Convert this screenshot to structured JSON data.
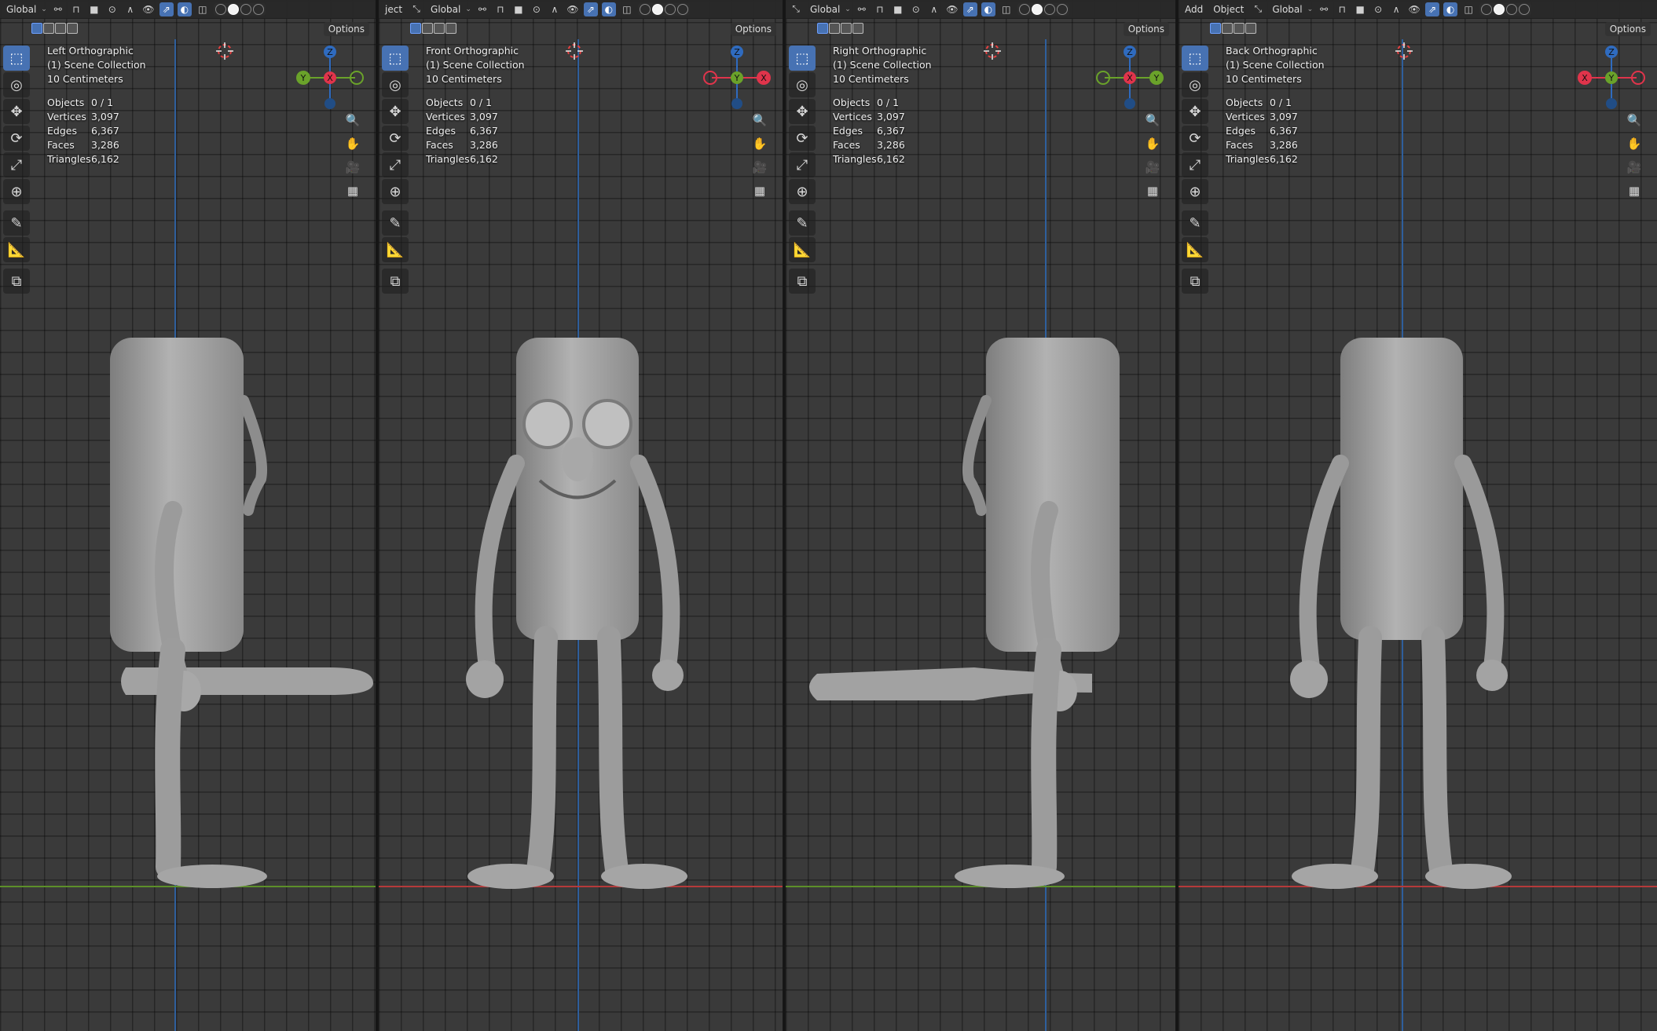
{
  "viewports": [
    {
      "header_left": "Global",
      "view_name": "Left Orthographic",
      "collection": "(1) Scene Collection",
      "scale": "10 Centimeters",
      "stats": {
        "objects_label": "Objects",
        "objects": "0 / 1",
        "vertices_label": "Vertices",
        "vertices": "3,097",
        "edges_label": "Edges",
        "edges": "6,367",
        "faces_label": "Faces",
        "faces": "3,286",
        "triangles_label": "Triangles",
        "triangles": "6,162"
      },
      "options_label": "Options",
      "ground_axis_color": "#5d8f2a",
      "gizmo": {
        "top": "Z",
        "left": "Y",
        "center": "X",
        "right_color": "#6aa22a",
        "left_color": "#6aa22a",
        "center_color": "#e0344b"
      }
    },
    {
      "header_left": "ject",
      "header_global": "Global",
      "view_name": "Front Orthographic",
      "collection": "(1) Scene Collection",
      "scale": "10 Centimeters",
      "stats": {
        "objects_label": "Objects",
        "objects": "0 / 1",
        "vertices_label": "Vertices",
        "vertices": "3,097",
        "edges_label": "Edges",
        "edges": "6,367",
        "faces_label": "Faces",
        "faces": "3,286",
        "triangles_label": "Triangles",
        "triangles": "6,162"
      },
      "options_label": "Options",
      "ground_axis_color": "#b53a3a",
      "gizmo": {
        "top": "Z",
        "left": "",
        "center": "Y",
        "right": "X",
        "right_color": "#e0344b",
        "left_color": "#e0344b",
        "center_color": "#6aa22a"
      }
    },
    {
      "header_global": "Global",
      "view_name": "Right Orthographic",
      "collection": "(1) Scene Collection",
      "scale": "10 Centimeters",
      "stats": {
        "objects_label": "Objects",
        "objects": "0 / 1",
        "vertices_label": "Vertices",
        "vertices": "3,097",
        "edges_label": "Edges",
        "edges": "6,367",
        "faces_label": "Faces",
        "faces": "3,286",
        "triangles_label": "Triangles",
        "triangles": "6,162"
      },
      "options_label": "Options",
      "ground_axis_color": "#5d8f2a",
      "gizmo": {
        "top": "Z",
        "left": "",
        "center": "X",
        "right": "Y",
        "right_color": "#6aa22a",
        "left_color": "#6aa22a",
        "center_color": "#e0344b"
      }
    },
    {
      "header_add": "Add",
      "header_object": "Object",
      "header_global": "Global",
      "view_name": "Back Orthographic",
      "collection": "(1) Scene Collection",
      "scale": "10 Centimeters",
      "stats": {
        "objects_label": "Objects",
        "objects": "0 / 1",
        "vertices_label": "Vertices",
        "vertices": "3,097",
        "edges_label": "Edges",
        "edges": "6,367",
        "faces_label": "Faces",
        "faces": "3,286",
        "triangles_label": "Triangles",
        "triangles": "6,162"
      },
      "options_label": "Options",
      "ground_axis_color": "#b53a3a",
      "gizmo": {
        "top": "Z",
        "left": "X",
        "center": "Y",
        "right": "",
        "right_color": "#e0344b",
        "left_color": "#e0344b",
        "center_color": "#6aa22a"
      }
    }
  ],
  "colors": {
    "accent": "#4772b3",
    "axis_blue": "#2f5f9c",
    "model_gray": "#9c9c9c"
  }
}
